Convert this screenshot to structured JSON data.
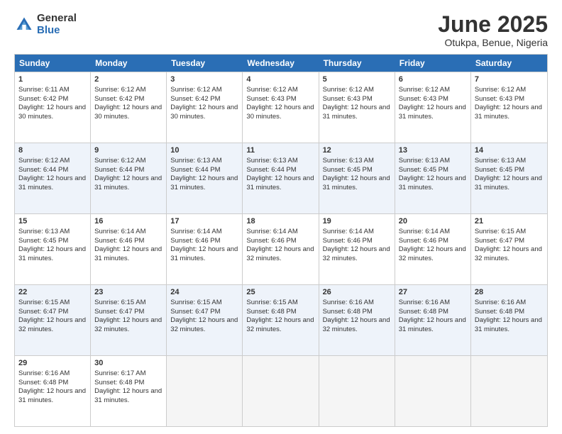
{
  "logo": {
    "general": "General",
    "blue": "Blue"
  },
  "title": {
    "month": "June 2025",
    "location": "Otukpa, Benue, Nigeria"
  },
  "header": {
    "days": [
      "Sunday",
      "Monday",
      "Tuesday",
      "Wednesday",
      "Thursday",
      "Friday",
      "Saturday"
    ]
  },
  "rows": [
    [
      {
        "day": "1",
        "sunrise": "6:11 AM",
        "sunset": "6:42 PM",
        "daylight": "12 hours and 30 minutes."
      },
      {
        "day": "2",
        "sunrise": "6:12 AM",
        "sunset": "6:42 PM",
        "daylight": "12 hours and 30 minutes."
      },
      {
        "day": "3",
        "sunrise": "6:12 AM",
        "sunset": "6:42 PM",
        "daylight": "12 hours and 30 minutes."
      },
      {
        "day": "4",
        "sunrise": "6:12 AM",
        "sunset": "6:43 PM",
        "daylight": "12 hours and 30 minutes."
      },
      {
        "day": "5",
        "sunrise": "6:12 AM",
        "sunset": "6:43 PM",
        "daylight": "12 hours and 31 minutes."
      },
      {
        "day": "6",
        "sunrise": "6:12 AM",
        "sunset": "6:43 PM",
        "daylight": "12 hours and 31 minutes."
      },
      {
        "day": "7",
        "sunrise": "6:12 AM",
        "sunset": "6:43 PM",
        "daylight": "12 hours and 31 minutes."
      }
    ],
    [
      {
        "day": "8",
        "sunrise": "6:12 AM",
        "sunset": "6:44 PM",
        "daylight": "12 hours and 31 minutes."
      },
      {
        "day": "9",
        "sunrise": "6:12 AM",
        "sunset": "6:44 PM",
        "daylight": "12 hours and 31 minutes."
      },
      {
        "day": "10",
        "sunrise": "6:13 AM",
        "sunset": "6:44 PM",
        "daylight": "12 hours and 31 minutes."
      },
      {
        "day": "11",
        "sunrise": "6:13 AM",
        "sunset": "6:44 PM",
        "daylight": "12 hours and 31 minutes."
      },
      {
        "day": "12",
        "sunrise": "6:13 AM",
        "sunset": "6:45 PM",
        "daylight": "12 hours and 31 minutes."
      },
      {
        "day": "13",
        "sunrise": "6:13 AM",
        "sunset": "6:45 PM",
        "daylight": "12 hours and 31 minutes."
      },
      {
        "day": "14",
        "sunrise": "6:13 AM",
        "sunset": "6:45 PM",
        "daylight": "12 hours and 31 minutes."
      }
    ],
    [
      {
        "day": "15",
        "sunrise": "6:13 AM",
        "sunset": "6:45 PM",
        "daylight": "12 hours and 31 minutes."
      },
      {
        "day": "16",
        "sunrise": "6:14 AM",
        "sunset": "6:46 PM",
        "daylight": "12 hours and 31 minutes."
      },
      {
        "day": "17",
        "sunrise": "6:14 AM",
        "sunset": "6:46 PM",
        "daylight": "12 hours and 31 minutes."
      },
      {
        "day": "18",
        "sunrise": "6:14 AM",
        "sunset": "6:46 PM",
        "daylight": "12 hours and 32 minutes."
      },
      {
        "day": "19",
        "sunrise": "6:14 AM",
        "sunset": "6:46 PM",
        "daylight": "12 hours and 32 minutes."
      },
      {
        "day": "20",
        "sunrise": "6:14 AM",
        "sunset": "6:46 PM",
        "daylight": "12 hours and 32 minutes."
      },
      {
        "day": "21",
        "sunrise": "6:15 AM",
        "sunset": "6:47 PM",
        "daylight": "12 hours and 32 minutes."
      }
    ],
    [
      {
        "day": "22",
        "sunrise": "6:15 AM",
        "sunset": "6:47 PM",
        "daylight": "12 hours and 32 minutes."
      },
      {
        "day": "23",
        "sunrise": "6:15 AM",
        "sunset": "6:47 PM",
        "daylight": "12 hours and 32 minutes."
      },
      {
        "day": "24",
        "sunrise": "6:15 AM",
        "sunset": "6:47 PM",
        "daylight": "12 hours and 32 minutes."
      },
      {
        "day": "25",
        "sunrise": "6:15 AM",
        "sunset": "6:48 PM",
        "daylight": "12 hours and 32 minutes."
      },
      {
        "day": "26",
        "sunrise": "6:16 AM",
        "sunset": "6:48 PM",
        "daylight": "12 hours and 32 minutes."
      },
      {
        "day": "27",
        "sunrise": "6:16 AM",
        "sunset": "6:48 PM",
        "daylight": "12 hours and 31 minutes."
      },
      {
        "day": "28",
        "sunrise": "6:16 AM",
        "sunset": "6:48 PM",
        "daylight": "12 hours and 31 minutes."
      }
    ],
    [
      {
        "day": "29",
        "sunrise": "6:16 AM",
        "sunset": "6:48 PM",
        "daylight": "12 hours and 31 minutes."
      },
      {
        "day": "30",
        "sunrise": "6:17 AM",
        "sunset": "6:48 PM",
        "daylight": "12 hours and 31 minutes."
      },
      null,
      null,
      null,
      null,
      null
    ]
  ]
}
